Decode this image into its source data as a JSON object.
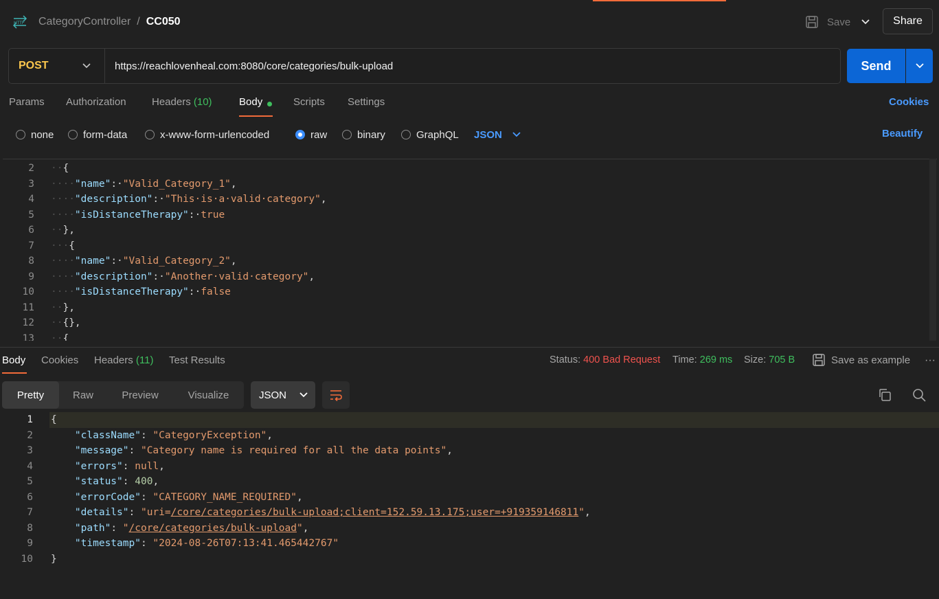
{
  "header": {
    "breadcrumb_parent": "CategoryController",
    "separator": "/",
    "request_name": "CC050",
    "save_label": "Save",
    "share_label": "Share"
  },
  "request": {
    "method": "POST",
    "url": "https://reachlovenheal.com:8080/core/categories/bulk-upload",
    "send_label": "Send"
  },
  "request_tabs": {
    "params": "Params",
    "authorization": "Authorization",
    "headers": "Headers",
    "headers_count": "(10)",
    "body": "Body",
    "scripts": "Scripts",
    "settings": "Settings",
    "cookies": "Cookies"
  },
  "body_types": {
    "none": "none",
    "form_data": "form-data",
    "urlencoded": "x-www-form-urlencoded",
    "raw": "raw",
    "binary": "binary",
    "graphql": "GraphQL",
    "language": "JSON",
    "beautify": "Beautify"
  },
  "request_body_lines": [
    {
      "n": "2",
      "dots": "··",
      "parts": [
        {
          "t": "{",
          "c": "p"
        }
      ]
    },
    {
      "n": "3",
      "dots": "····",
      "parts": [
        {
          "t": "\"name\"",
          "c": "k"
        },
        {
          "t": ":·",
          "c": "p"
        },
        {
          "t": "\"Valid_Category_1\"",
          "c": "s"
        },
        {
          "t": ",",
          "c": "p"
        }
      ]
    },
    {
      "n": "4",
      "dots": "····",
      "parts": [
        {
          "t": "\"description\"",
          "c": "k"
        },
        {
          "t": ":·",
          "c": "p"
        },
        {
          "t": "\"This·is·a·valid·category\"",
          "c": "s"
        },
        {
          "t": ",",
          "c": "p"
        }
      ]
    },
    {
      "n": "5",
      "dots": "····",
      "parts": [
        {
          "t": "\"isDistanceTherapy\"",
          "c": "k"
        },
        {
          "t": ":·",
          "c": "p"
        },
        {
          "t": "true",
          "c": "b"
        }
      ]
    },
    {
      "n": "6",
      "dots": "··",
      "parts": [
        {
          "t": "},",
          "c": "p"
        }
      ]
    },
    {
      "n": "7",
      "dots": "···",
      "parts": [
        {
          "t": "{",
          "c": "p"
        }
      ]
    },
    {
      "n": "8",
      "dots": "····",
      "parts": [
        {
          "t": "\"name\"",
          "c": "k"
        },
        {
          "t": ":·",
          "c": "p"
        },
        {
          "t": "\"Valid_Category_2\"",
          "c": "s"
        },
        {
          "t": ",",
          "c": "p"
        }
      ]
    },
    {
      "n": "9",
      "dots": "····",
      "parts": [
        {
          "t": "\"description\"",
          "c": "k"
        },
        {
          "t": ":·",
          "c": "p"
        },
        {
          "t": "\"Another·valid·category\"",
          "c": "s"
        },
        {
          "t": ",",
          "c": "p"
        }
      ]
    },
    {
      "n": "10",
      "dots": "····",
      "parts": [
        {
          "t": "\"isDistanceTherapy\"",
          "c": "k"
        },
        {
          "t": ":·",
          "c": "p"
        },
        {
          "t": "false",
          "c": "b"
        }
      ]
    },
    {
      "n": "11",
      "dots": "··",
      "parts": [
        {
          "t": "},",
          "c": "p"
        }
      ]
    },
    {
      "n": "12",
      "dots": "··",
      "parts": [
        {
          "t": "{},",
          "c": "p"
        }
      ]
    },
    {
      "n": "13",
      "dots": "··",
      "parts": [
        {
          "t": "{",
          "c": "p"
        }
      ]
    }
  ],
  "response_tabs": {
    "body": "Body",
    "cookies": "Cookies",
    "headers": "Headers",
    "headers_count": "(11)",
    "test_results": "Test Results"
  },
  "response_meta": {
    "status_label": "Status:",
    "status_value": "400 Bad Request",
    "time_label": "Time:",
    "time_value": "269 ms",
    "size_label": "Size:",
    "size_value": "705 B",
    "save_example": "Save as example",
    "more": "···"
  },
  "response_view": {
    "pretty": "Pretty",
    "raw": "Raw",
    "preview": "Preview",
    "visualize": "Visualize",
    "format": "JSON"
  },
  "response_body_lines": [
    {
      "n": "1",
      "parts": [
        {
          "t": "{",
          "c": "p"
        }
      ]
    },
    {
      "n": "2",
      "parts": [
        {
          "t": "    \"className\"",
          "c": "k"
        },
        {
          "t": ": ",
          "c": "p"
        },
        {
          "t": "\"CategoryException\"",
          "c": "s"
        },
        {
          "t": ",",
          "c": "p"
        }
      ]
    },
    {
      "n": "3",
      "parts": [
        {
          "t": "    \"message\"",
          "c": "k"
        },
        {
          "t": ": ",
          "c": "p"
        },
        {
          "t": "\"Category name is required for all the data points\"",
          "c": "s"
        },
        {
          "t": ",",
          "c": "p"
        }
      ]
    },
    {
      "n": "4",
      "parts": [
        {
          "t": "    \"errors\"",
          "c": "k"
        },
        {
          "t": ": ",
          "c": "p"
        },
        {
          "t": "null",
          "c": "b"
        },
        {
          "t": ",",
          "c": "p"
        }
      ]
    },
    {
      "n": "5",
      "parts": [
        {
          "t": "    \"status\"",
          "c": "k"
        },
        {
          "t": ": ",
          "c": "p"
        },
        {
          "t": "400",
          "c": "n"
        },
        {
          "t": ",",
          "c": "p"
        }
      ]
    },
    {
      "n": "6",
      "parts": [
        {
          "t": "    \"errorCode\"",
          "c": "k"
        },
        {
          "t": ": ",
          "c": "p"
        },
        {
          "t": "\"CATEGORY_NAME_REQUIRED\"",
          "c": "s"
        },
        {
          "t": ",",
          "c": "p"
        }
      ]
    },
    {
      "n": "7",
      "parts": [
        {
          "t": "    \"details\"",
          "c": "k"
        },
        {
          "t": ": ",
          "c": "p"
        },
        {
          "t": "\"uri=",
          "c": "s"
        },
        {
          "t": "/core/categories/bulk-upload;client=152.59.13.175;user=+919359146811",
          "c": "s u"
        },
        {
          "t": "\"",
          "c": "s"
        },
        {
          "t": ",",
          "c": "p"
        }
      ]
    },
    {
      "n": "8",
      "parts": [
        {
          "t": "    \"path\"",
          "c": "k"
        },
        {
          "t": ": ",
          "c": "p"
        },
        {
          "t": "\"",
          "c": "s"
        },
        {
          "t": "/core/categories/bulk-upload",
          "c": "s u"
        },
        {
          "t": "\"",
          "c": "s"
        },
        {
          "t": ",",
          "c": "p"
        }
      ]
    },
    {
      "n": "9",
      "parts": [
        {
          "t": "    \"timestamp\"",
          "c": "k"
        },
        {
          "t": ": ",
          "c": "p"
        },
        {
          "t": "\"2024-08-26T07:13:41.465442767\"",
          "c": "s"
        }
      ]
    },
    {
      "n": "10",
      "parts": [
        {
          "t": "}",
          "c": "p"
        }
      ]
    }
  ]
}
